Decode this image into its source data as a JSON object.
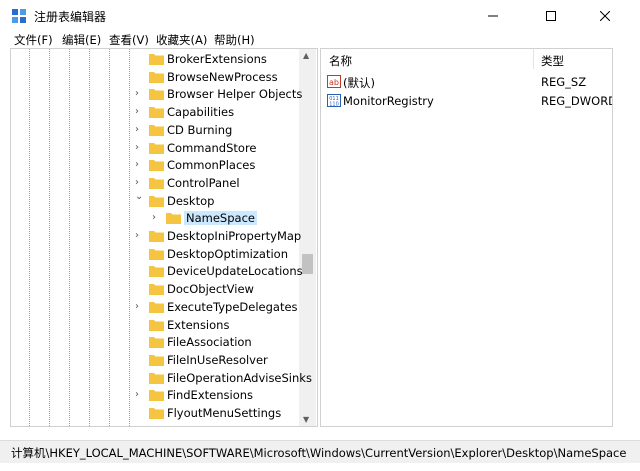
{
  "window": {
    "title": "注册表编辑器"
  },
  "menu": [
    "文件(F)",
    "编辑(E)",
    "查看(V)",
    "收藏夹(A)",
    "帮助(H)"
  ],
  "tree": {
    "items": [
      {
        "label": "BrokerExtensions",
        "expandable": false
      },
      {
        "label": "BrowseNewProcess",
        "expandable": false
      },
      {
        "label": "Browser Helper Objects",
        "expandable": true
      },
      {
        "label": "Capabilities",
        "expandable": true
      },
      {
        "label": "CD Burning",
        "expandable": true
      },
      {
        "label": "CommandStore",
        "expandable": true
      },
      {
        "label": "CommonPlaces",
        "expandable": true
      },
      {
        "label": "ControlPanel",
        "expandable": true
      },
      {
        "label": "Desktop",
        "expandable": true,
        "expanded": true
      },
      {
        "label": "NameSpace",
        "expandable": true,
        "selected": true,
        "child": true
      },
      {
        "label": "DesktopIniPropertyMap",
        "expandable": true
      },
      {
        "label": "DesktopOptimization",
        "expandable": false
      },
      {
        "label": "DeviceUpdateLocations",
        "expandable": false
      },
      {
        "label": "DocObjectView",
        "expandable": false
      },
      {
        "label": "ExecuteTypeDelegates",
        "expandable": true
      },
      {
        "label": "Extensions",
        "expandable": false
      },
      {
        "label": "FileAssociation",
        "expandable": false
      },
      {
        "label": "FileInUseResolver",
        "expandable": false
      },
      {
        "label": "FileOperationAdviseSinks",
        "expandable": false
      },
      {
        "label": "FindExtensions",
        "expandable": true
      },
      {
        "label": "FlyoutMenuSettings",
        "expandable": false
      }
    ]
  },
  "list": {
    "headers": {
      "name": "名称",
      "type": "类型"
    },
    "rows": [
      {
        "name": "(默认)",
        "type": "REG_SZ",
        "icon": "string-value-icon"
      },
      {
        "name": "MonitorRegistry",
        "type": "REG_DWORD",
        "icon": "binary-value-icon"
      }
    ]
  },
  "status": {
    "path": "计算机\\HKEY_LOCAL_MACHINE\\SOFTWARE\\Microsoft\\Windows\\CurrentVersion\\Explorer\\Desktop\\NameSpace"
  },
  "colors": {
    "folder": "#f5c542",
    "selection": "#cce8ff"
  }
}
